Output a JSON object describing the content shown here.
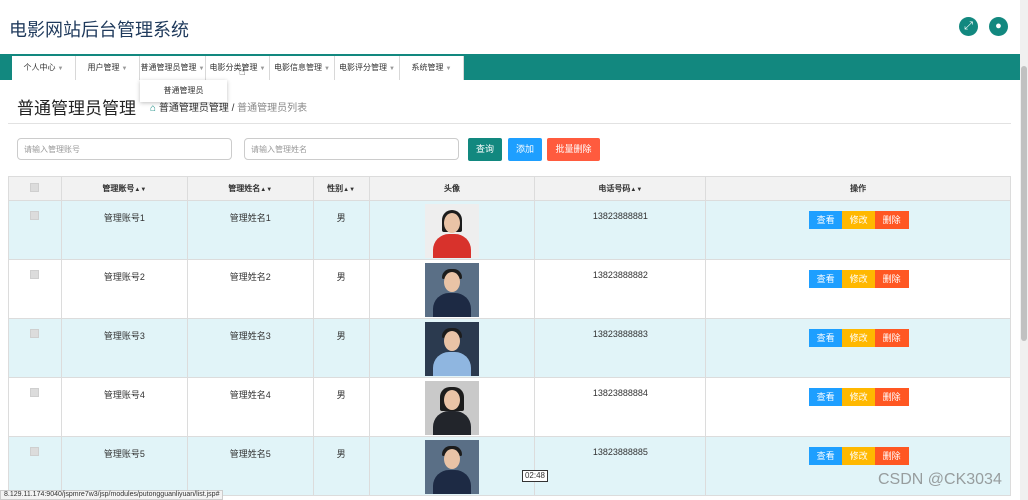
{
  "app": {
    "title": "电影网站后台管理系统"
  },
  "header_icons": [
    "fullscreen-icon",
    "user-icon"
  ],
  "nav": {
    "items": [
      {
        "label": "个人中心"
      },
      {
        "label": "用户管理"
      },
      {
        "label": "普通管理员管理"
      },
      {
        "label": "电影分类管理"
      },
      {
        "label": "电影信息管理"
      },
      {
        "label": "电影评分管理"
      },
      {
        "label": "系统管理"
      }
    ],
    "dropdown_item": "普通管理员"
  },
  "page": {
    "title": "普通管理员管理",
    "breadcrumb": {
      "section": "普通管理员管理",
      "sep": "/",
      "current": "普通管理员列表"
    }
  },
  "search": {
    "account_placeholder": "请输入管理账号",
    "name_placeholder": "请输入管理姓名",
    "query_label": "查询",
    "add_label": "添加",
    "batch_delete_label": "批量删除"
  },
  "table": {
    "columns": [
      "管理账号",
      "管理姓名",
      "性别",
      "头像",
      "电话号码",
      "操作"
    ],
    "actions": {
      "view": "查看",
      "edit": "修改",
      "delete": "删除"
    },
    "rows": [
      {
        "account": "管理账号1",
        "name": "管理姓名1",
        "gender": "男",
        "phone": "13823888881",
        "avatar": "woman-red-dress-photo"
      },
      {
        "account": "管理账号2",
        "name": "管理姓名2",
        "gender": "男",
        "phone": "13823888882",
        "avatar": "man-navy-suit-photo"
      },
      {
        "account": "管理账号3",
        "name": "管理姓名3",
        "gender": "男",
        "phone": "13823888883",
        "avatar": "man-blue-shirt-photo"
      },
      {
        "account": "管理账号4",
        "name": "管理姓名4",
        "gender": "男",
        "phone": "13823888884",
        "avatar": "woman-dark-suit-photo"
      },
      {
        "account": "管理账号5",
        "name": "管理姓名5",
        "gender": "男",
        "phone": "13823888885",
        "avatar": "man-navy-suit-photo"
      }
    ]
  },
  "status": {
    "url": "8.129.11.174:9040/jspmre7w3/jsp/modules/putongguanliyuan/list.jsp#",
    "time": "02:48",
    "watermark": "CSDN @CK3034"
  },
  "colors": {
    "accent": "#12887f",
    "view": "#1e9fff",
    "edit": "#ffb800",
    "delete": "#ff5722",
    "batch_delete": "#ff5b3e",
    "row_alt": "#e1f4f8"
  }
}
